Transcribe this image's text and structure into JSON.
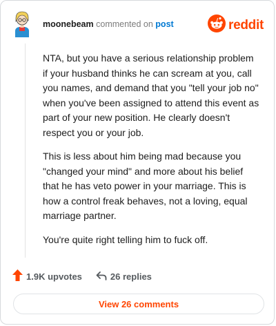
{
  "header": {
    "username": "moonebeam",
    "verb": "commented on",
    "target": "post",
    "brand": "reddit"
  },
  "comment": {
    "paragraphs": [
      "NTA, but you have a serious relationship problem if your husband thinks he can scream at you, call you names, and demand that you \"tell your job no\" when you've been assigned to attend this event as part of your new position. He clearly doesn't respect you or your job.",
      "This is less about him being mad because you \"changed your mind\" and more about his belief that he has veto power in your marriage. This is how a control freak behaves, not a loving, equal marriage partner.",
      "You're quite right telling him to fuck off."
    ]
  },
  "footer": {
    "upvotes": "1.9K upvotes",
    "replies": "26 replies",
    "view_comments": "View 26 comments"
  },
  "colors": {
    "accent": "#ff4500",
    "link": "#0079d3",
    "muted": "#7c7c7c"
  }
}
